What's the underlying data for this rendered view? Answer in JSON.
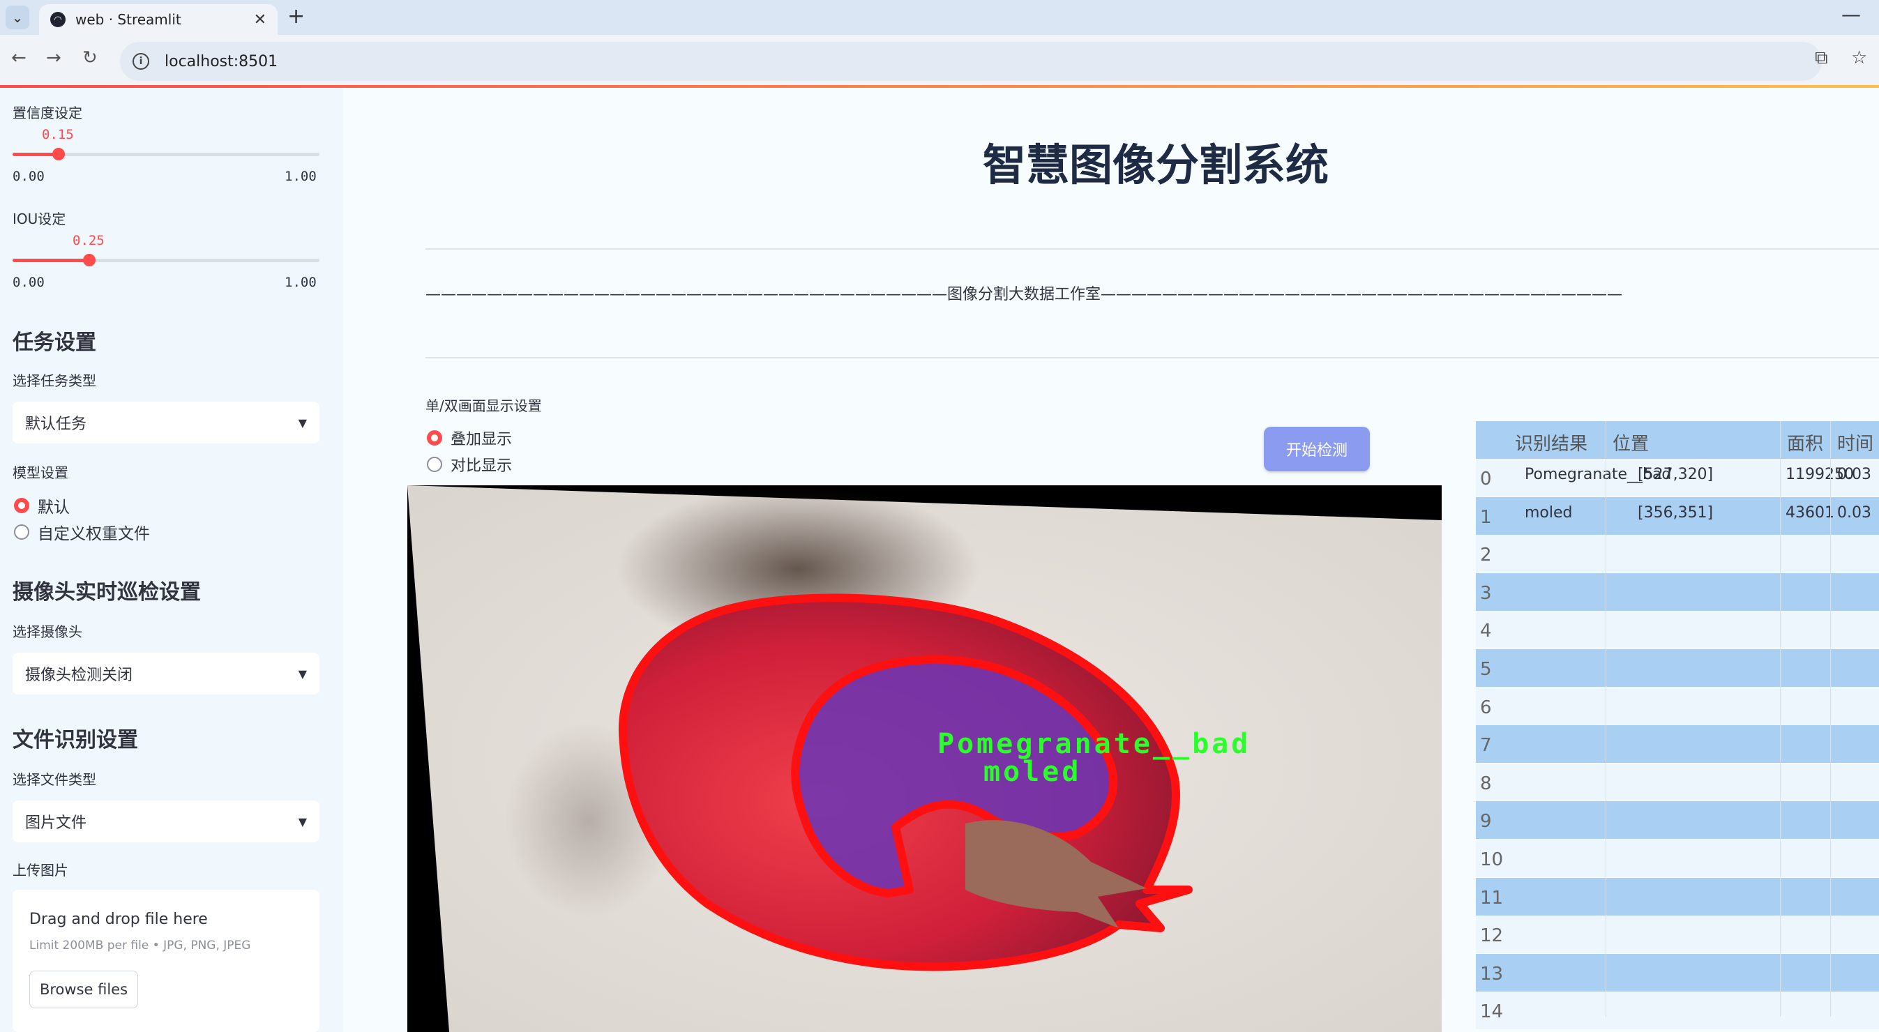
{
  "browser": {
    "tab_title": "web · Streamlit",
    "url": "localhost:8501"
  },
  "sidebar": {
    "confidence": {
      "label": "置信度设定",
      "value": "0.15",
      "min": "0.00",
      "max": "1.00",
      "fraction": 0.15
    },
    "iou": {
      "label": "IOU设定",
      "value": "0.25",
      "min": "0.00",
      "max": "1.00",
      "fraction": 0.25
    },
    "task_heading": "任务设置",
    "task_type_label": "选择任务类型",
    "task_type_value": "默认任务",
    "model_label": "模型设置",
    "model_options": [
      "默认",
      "自定义权重文件"
    ],
    "camera_heading": "摄像头实时巡检设置",
    "camera_label": "选择摄像头",
    "camera_value": "摄像头检测关闭",
    "file_heading": "文件识别设置",
    "file_type_label": "选择文件类型",
    "file_type_value": "图片文件",
    "upload_label": "上传图片",
    "upload_title": "Drag and drop file here",
    "upload_limit": "Limit 200MB per file • JPG, PNG, JPEG",
    "browse_label": "Browse files"
  },
  "main": {
    "title": "智慧图像分割系统",
    "subtitle_line": "——————————————————————————————————图像分割大数据工作室——————————————————————————————————",
    "display_label": "单/双画面显示设置",
    "display_options": [
      "叠加显示",
      "对比显示"
    ],
    "start_button": "开始检测",
    "overlay_labels": [
      "Pomegranate__bad",
      "moled"
    ]
  },
  "table": {
    "headers": [
      "识别结果",
      "位置",
      "面积",
      "时间"
    ],
    "rows": [
      {
        "index": "0",
        "result": "Pomegranate__bad",
        "position": "[527,320]",
        "area": "1199250",
        "time": "0.03"
      },
      {
        "index": "1",
        "result": "moled",
        "position": "[356,351]",
        "area": "43601",
        "time": "0.03"
      },
      {
        "index": "2"
      },
      {
        "index": "3"
      },
      {
        "index": "4"
      },
      {
        "index": "5"
      },
      {
        "index": "6"
      },
      {
        "index": "7"
      },
      {
        "index": "8"
      },
      {
        "index": "9"
      },
      {
        "index": "10"
      },
      {
        "index": "11"
      },
      {
        "index": "12"
      },
      {
        "index": "13"
      },
      {
        "index": "14"
      }
    ]
  },
  "colors": {
    "accent": "#ff4b4b",
    "button": "#8b9bf0",
    "table_stripe": "#a9cff3",
    "segment_outline": "#ff1010"
  }
}
